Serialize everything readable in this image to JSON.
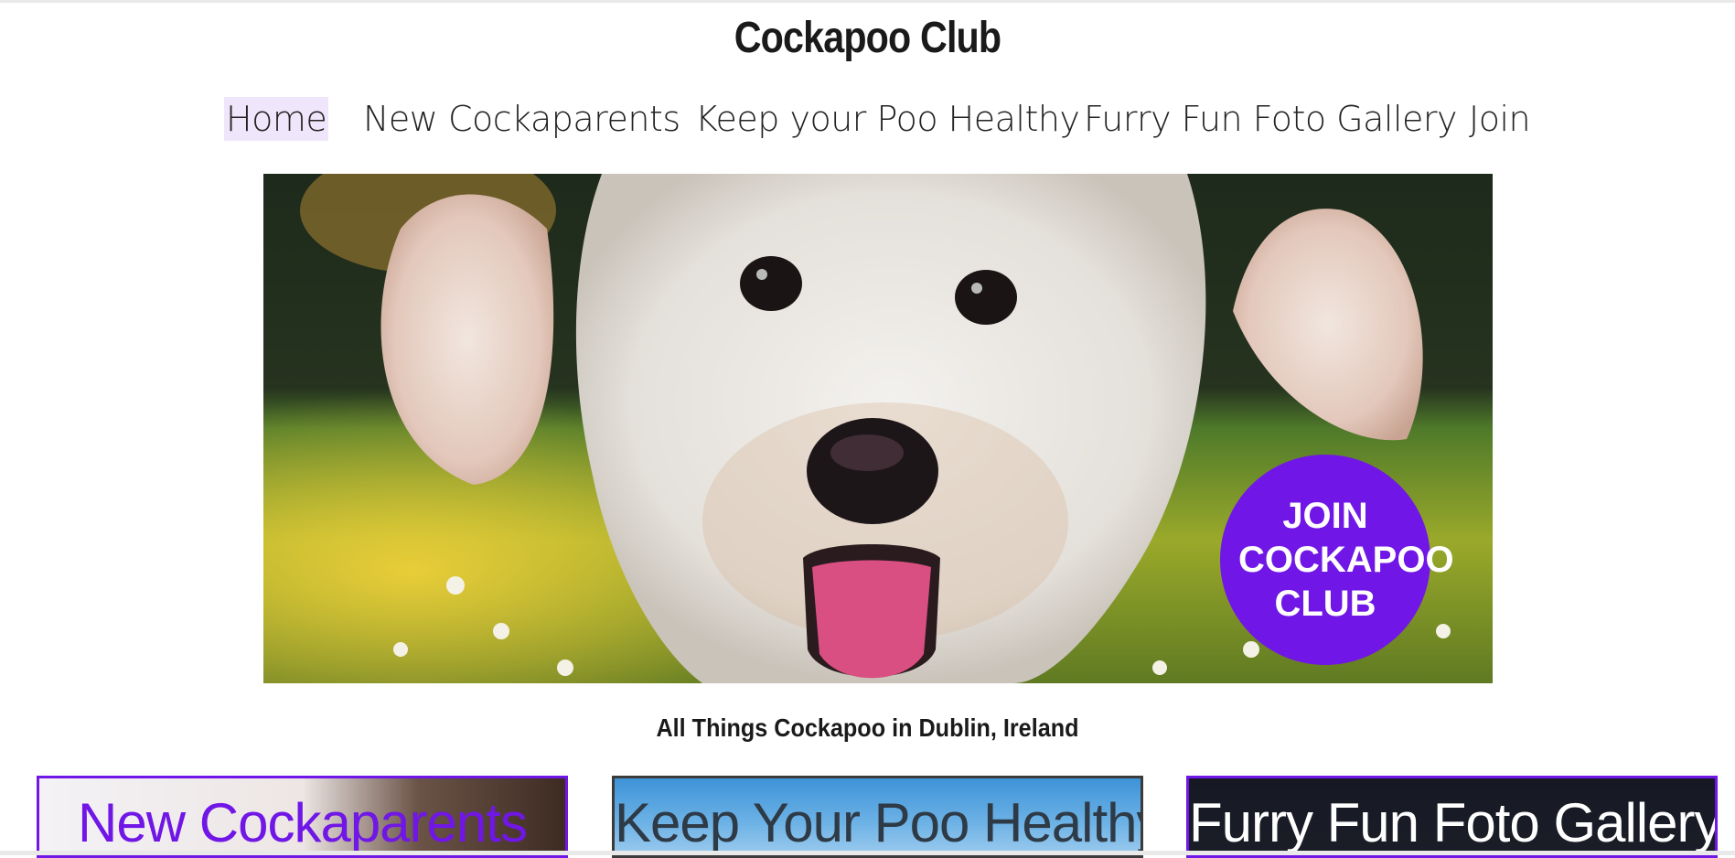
{
  "site": {
    "title": "Cockapoo Club"
  },
  "nav": {
    "items": [
      {
        "label": "Home",
        "active": true
      },
      {
        "label": "New Cockaparents",
        "active": false
      },
      {
        "label": "Keep your Poo Healthy",
        "active": false
      },
      {
        "label": "Furry Fun Foto Gallery",
        "active": false
      },
      {
        "label": "Join",
        "active": false
      }
    ]
  },
  "hero": {
    "cta_label": "JOIN COCKAPOO CLUB"
  },
  "tagline": "All Things Cockapoo in Dublin, Ireland",
  "cards": [
    {
      "title": "New Cockaparents"
    },
    {
      "title": "Keep Your Poo Healthy"
    },
    {
      "title": "Furry Fun Foto Gallery"
    }
  ],
  "colors": {
    "accent": "#7016e6",
    "nav_active_bg": "#f0e6fb",
    "text": "#1a1a1a"
  }
}
